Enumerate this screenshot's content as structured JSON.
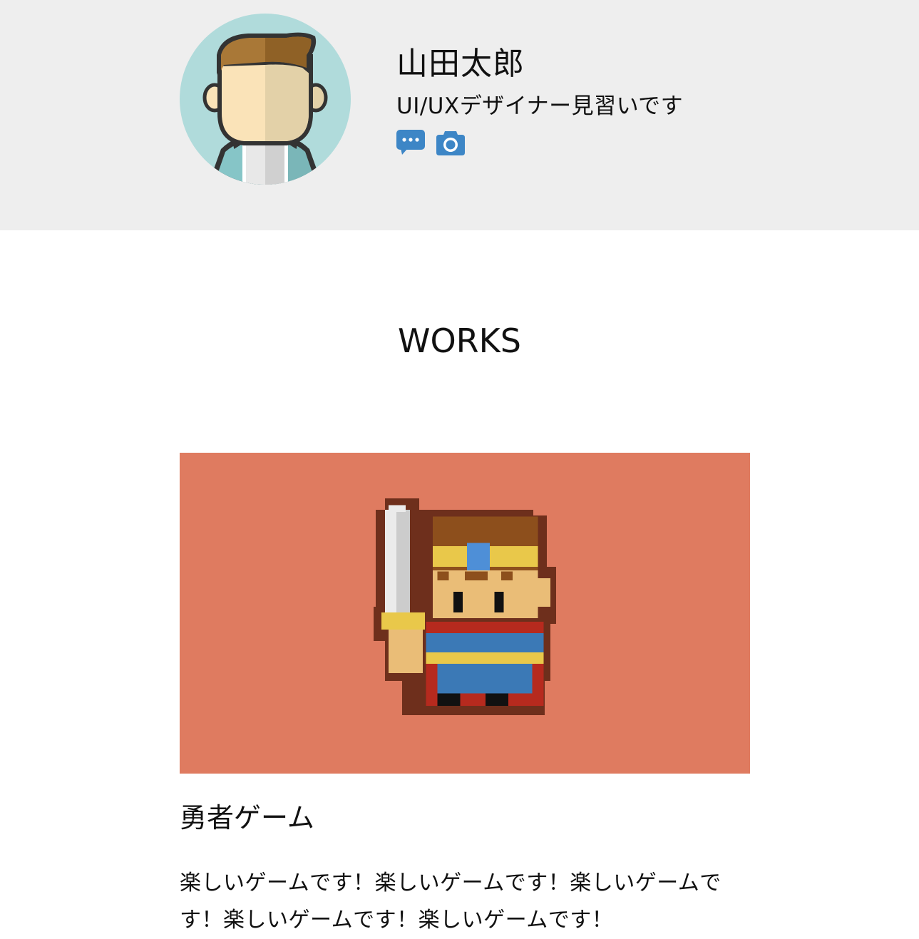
{
  "profile": {
    "name": "山田太郎",
    "role": "UI/UXデザイナー見習いです",
    "social_icons": [
      "chat-bubble-icon",
      "camera-icon"
    ],
    "accent_color": "#3d86c6"
  },
  "works": {
    "heading": "WORKS",
    "items": [
      {
        "title": "勇者ゲーム",
        "description": "楽しいゲームです！楽しいゲームです！楽しいゲームです！楽しいゲームです！楽しいゲームです！",
        "image_icon": "pixel-hero-icon",
        "image_bg": "#df7b60"
      }
    ]
  }
}
